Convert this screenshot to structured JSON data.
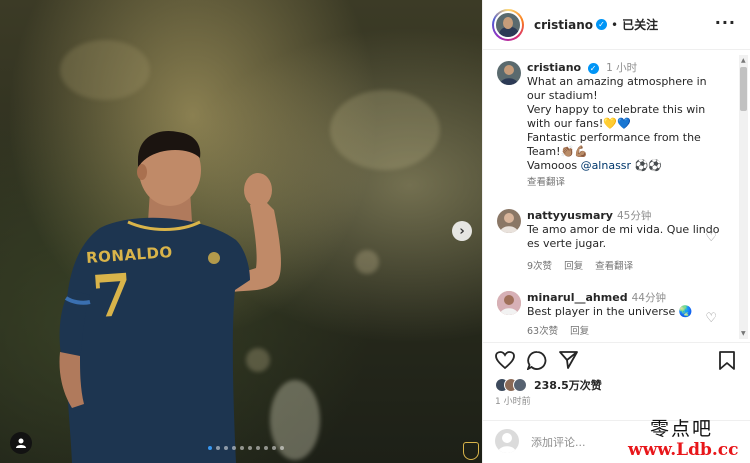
{
  "post": {
    "username": "cristiano",
    "follow_status": "已关注",
    "separator": "•",
    "more_label": "···"
  },
  "caption": {
    "username": "cristiano",
    "time": "1 小时",
    "lines": [
      "What an amazing atmosphere in our stadium!",
      "Very happy to celebrate this win with our fans!💛💙",
      "Fantastic performance from the Team!👏🏽💪🏽",
      "Vamooos"
    ],
    "mention": "@alnassr",
    "mention_suffix": "⚽⚽",
    "translate": "查看翻译"
  },
  "comments": [
    {
      "username": "nattyyusmary",
      "time": "45分钟",
      "text": "Te amo amor de mi vida. Que lindo es verte jugar.",
      "likes": "9次赞",
      "reply": "回复",
      "translate": "查看翻译"
    },
    {
      "username": "minarul__ahmed",
      "time": "44分钟",
      "text": "Best player in the universe 🌏",
      "likes": "63次赞",
      "reply": "回复",
      "translate": ""
    }
  ],
  "photo": {
    "jersey_name": "RONALDO",
    "jersey_number": "7"
  },
  "actions": {
    "likes": "238.5万次赞",
    "time": "1 小时前"
  },
  "add_comment": {
    "placeholder": "添加评论..."
  },
  "watermark": {
    "line1": "零点吧",
    "line2": "www.Ldb.cc"
  },
  "carousel": {
    "count": 10,
    "active_index": 0
  },
  "colors": {
    "verified": "#0095f6",
    "link": "#00376b",
    "watermark_red": "#e8161a",
    "jersey_gold": "#d9b44a"
  }
}
